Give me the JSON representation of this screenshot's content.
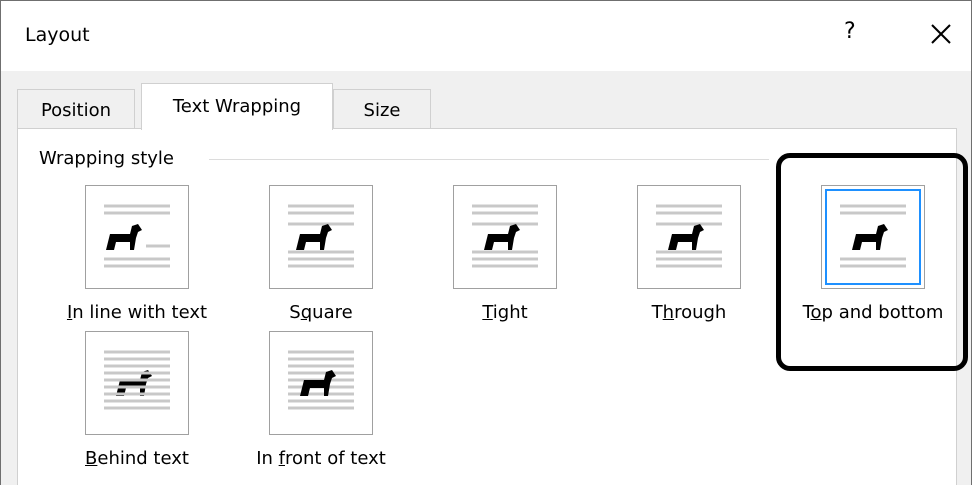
{
  "dialog": {
    "title": "Layout",
    "help_label": "?",
    "close_icon": "close-icon"
  },
  "tabs": [
    {
      "label": "Position"
    },
    {
      "label": "Text Wrapping"
    },
    {
      "label": "Size"
    }
  ],
  "active_tab": "Text Wrapping",
  "wrapping_style": {
    "group_label": "Wrapping style",
    "options": [
      {
        "label": "In line with text",
        "underline_char": "I",
        "rest": "n line with text"
      },
      {
        "label": "Square",
        "underline_pre": "S",
        "underline_char": "q",
        "rest": "uare"
      },
      {
        "label": "Tight",
        "underline_char": "T",
        "rest": "ight"
      },
      {
        "label": "Through",
        "underline_pre": "T",
        "underline_char": "h",
        "rest": "rough"
      },
      {
        "label": "Top and bottom",
        "underline_pre": "T",
        "underline_char": "o",
        "rest": "p and bottom"
      },
      {
        "label": "Behind text",
        "underline_char": "B",
        "rest": "ehind text"
      },
      {
        "label": "In front of text",
        "underline_pre": "In ",
        "underline_char": "f",
        "rest": "ront of text"
      }
    ],
    "selected": "Top and bottom"
  },
  "colors": {
    "selection_border": "#1e90ff",
    "highlight_ring": "#000000"
  }
}
